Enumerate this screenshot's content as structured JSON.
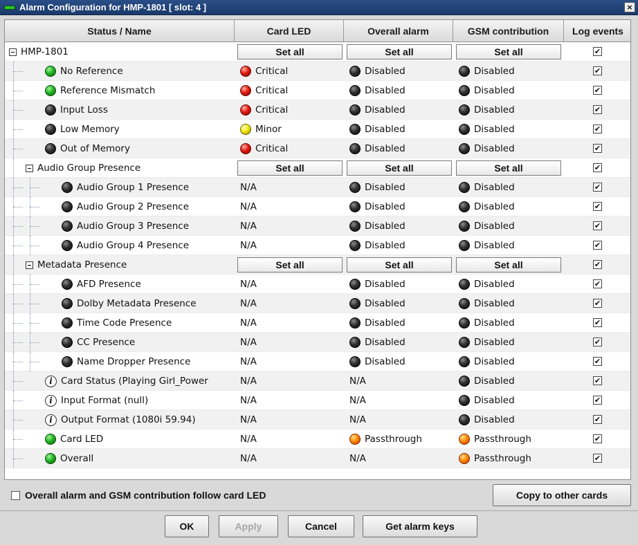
{
  "window": {
    "title": "Alarm Configuration for HMP-1801 [ slot: 4 ]",
    "close_glyph": "×"
  },
  "table": {
    "headers": [
      "Status / Name",
      "Card LED",
      "Overall alarm",
      "GSM contribution",
      "Log events"
    ],
    "set_all_label": "Set all",
    "checked_glyph": "✔",
    "rows": [
      {
        "name": "HMP-1801",
        "level": 0,
        "group": true,
        "icon": "expander",
        "card_led": "setall",
        "overall": "setall",
        "gsm": "setall",
        "log": true
      },
      {
        "name": "No Reference",
        "level": 1,
        "icon": "green",
        "card_led": {
          "led": "red",
          "text": "Critical"
        },
        "overall": {
          "led": "black",
          "text": "Disabled"
        },
        "gsm": {
          "led": "black",
          "text": "Disabled"
        },
        "log": true
      },
      {
        "name": "Reference Mismatch",
        "level": 1,
        "icon": "green",
        "card_led": {
          "led": "red",
          "text": "Critical"
        },
        "overall": {
          "led": "black",
          "text": "Disabled"
        },
        "gsm": {
          "led": "black",
          "text": "Disabled"
        },
        "log": true
      },
      {
        "name": "Input Loss",
        "level": 1,
        "icon": "black",
        "card_led": {
          "led": "red",
          "text": "Critical"
        },
        "overall": {
          "led": "black",
          "text": "Disabled"
        },
        "gsm": {
          "led": "black",
          "text": "Disabled"
        },
        "log": true
      },
      {
        "name": "Low Memory",
        "level": 1,
        "icon": "black",
        "card_led": {
          "led": "yellow",
          "text": "Minor"
        },
        "overall": {
          "led": "black",
          "text": "Disabled"
        },
        "gsm": {
          "led": "black",
          "text": "Disabled"
        },
        "log": true
      },
      {
        "name": "Out of Memory",
        "level": 1,
        "icon": "black",
        "card_led": {
          "led": "red",
          "text": "Critical"
        },
        "overall": {
          "led": "black",
          "text": "Disabled"
        },
        "gsm": {
          "led": "black",
          "text": "Disabled"
        },
        "log": true
      },
      {
        "name": "Audio Group Presence",
        "level": 1,
        "group": true,
        "icon": "expander",
        "card_led": "setall",
        "overall": "setall",
        "gsm": "setall",
        "log": true
      },
      {
        "name": "Audio Group 1 Presence",
        "level": 2,
        "icon": "black",
        "card_led": {
          "text": "N/A"
        },
        "overall": {
          "led": "black",
          "text": "Disabled"
        },
        "gsm": {
          "led": "black",
          "text": "Disabled"
        },
        "log": true
      },
      {
        "name": "Audio Group 2 Presence",
        "level": 2,
        "icon": "black",
        "card_led": {
          "text": "N/A"
        },
        "overall": {
          "led": "black",
          "text": "Disabled"
        },
        "gsm": {
          "led": "black",
          "text": "Disabled"
        },
        "log": true
      },
      {
        "name": "Audio Group 3 Presence",
        "level": 2,
        "icon": "black",
        "card_led": {
          "text": "N/A"
        },
        "overall": {
          "led": "black",
          "text": "Disabled"
        },
        "gsm": {
          "led": "black",
          "text": "Disabled"
        },
        "log": true
      },
      {
        "name": "Audio Group 4 Presence",
        "level": 2,
        "icon": "black",
        "card_led": {
          "text": "N/A"
        },
        "overall": {
          "led": "black",
          "text": "Disabled"
        },
        "gsm": {
          "led": "black",
          "text": "Disabled"
        },
        "log": true
      },
      {
        "name": "Metadata Presence",
        "level": 1,
        "group": true,
        "icon": "expander",
        "card_led": "setall",
        "overall": "setall",
        "gsm": "setall",
        "log": true
      },
      {
        "name": "AFD Presence",
        "level": 2,
        "icon": "black",
        "card_led": {
          "text": "N/A"
        },
        "overall": {
          "led": "black",
          "text": "Disabled"
        },
        "gsm": {
          "led": "black",
          "text": "Disabled"
        },
        "log": true
      },
      {
        "name": "Dolby Metadata Presence",
        "level": 2,
        "icon": "black",
        "card_led": {
          "text": "N/A"
        },
        "overall": {
          "led": "black",
          "text": "Disabled"
        },
        "gsm": {
          "led": "black",
          "text": "Disabled"
        },
        "log": true
      },
      {
        "name": "Time Code Presence",
        "level": 2,
        "icon": "black",
        "card_led": {
          "text": "N/A"
        },
        "overall": {
          "led": "black",
          "text": "Disabled"
        },
        "gsm": {
          "led": "black",
          "text": "Disabled"
        },
        "log": true
      },
      {
        "name": "CC Presence",
        "level": 2,
        "icon": "black",
        "card_led": {
          "text": "N/A"
        },
        "overall": {
          "led": "black",
          "text": "Disabled"
        },
        "gsm": {
          "led": "black",
          "text": "Disabled"
        },
        "log": true
      },
      {
        "name": "Name Dropper Presence",
        "level": 2,
        "icon": "black",
        "card_led": {
          "text": "N/A"
        },
        "overall": {
          "led": "black",
          "text": "Disabled"
        },
        "gsm": {
          "led": "black",
          "text": "Disabled"
        },
        "log": true
      },
      {
        "name": "Card Status (Playing Girl_Power",
        "level": 1,
        "icon": "info",
        "card_led": {
          "text": "N/A"
        },
        "overall": {
          "text": "N/A"
        },
        "gsm": {
          "led": "black",
          "text": "Disabled"
        },
        "log": true
      },
      {
        "name": "Input Format (null)",
        "level": 1,
        "icon": "info",
        "card_led": {
          "text": "N/A"
        },
        "overall": {
          "text": "N/A"
        },
        "gsm": {
          "led": "black",
          "text": "Disabled"
        },
        "log": true
      },
      {
        "name": "Output Format (1080i 59.94)",
        "level": 1,
        "icon": "info",
        "card_led": {
          "text": "N/A"
        },
        "overall": {
          "text": "N/A"
        },
        "gsm": {
          "led": "black",
          "text": "Disabled"
        },
        "log": true
      },
      {
        "name": "Card LED",
        "level": 1,
        "icon": "green",
        "card_led": {
          "text": "N/A"
        },
        "overall": {
          "led": "orange",
          "text": "Passthrough"
        },
        "gsm": {
          "led": "orange",
          "text": "Passthrough"
        },
        "log": true
      },
      {
        "name": "Overall",
        "level": 1,
        "icon": "green",
        "card_led": {
          "text": "N/A"
        },
        "overall": {
          "text": "N/A"
        },
        "gsm": {
          "led": "orange",
          "text": "Passthrough"
        },
        "log": true
      }
    ]
  },
  "options": {
    "follow_label": "Overall alarm and GSM contribution follow card LED",
    "follow_checked": false,
    "copy_button": "Copy to other cards"
  },
  "buttons": {
    "ok": "OK",
    "apply": "Apply",
    "cancel": "Cancel",
    "get_alarm_keys": "Get alarm keys"
  }
}
